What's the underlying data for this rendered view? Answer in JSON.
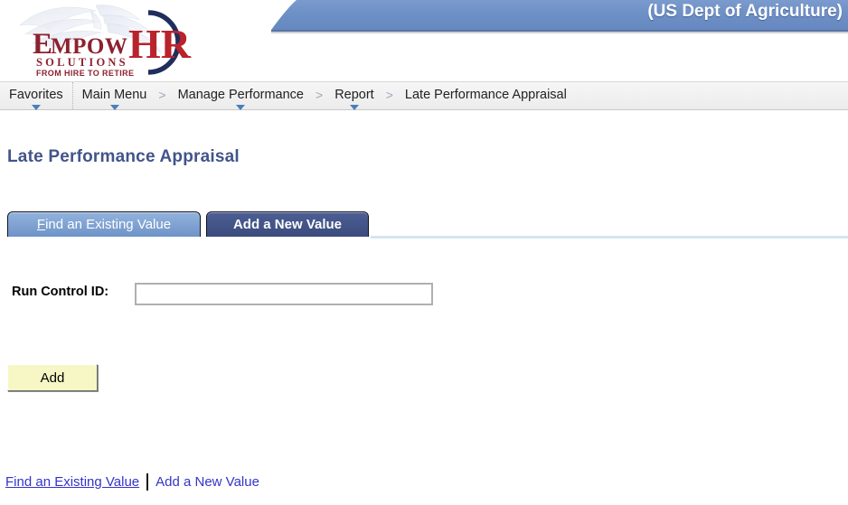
{
  "header": {
    "banner_title": "(US Dept of Agriculture)",
    "banner_color": "#6d90c6",
    "banner_border_color": "#3d5a93",
    "logo": {
      "word_1": "E",
      "word_1_rest": "MPOW",
      "word_2": "HR",
      "tagline_1": "S O L U T I O N S",
      "tagline_2": "FROM HIRE TO RETIRE",
      "color_empow": "#8c2230",
      "color_hr": "#b8232c",
      "color_arc": "#1f2e5c",
      "color_tagline": "#8c2230"
    }
  },
  "nav": {
    "items": [
      {
        "label": "Favorites",
        "caret": true,
        "separator_before": false
      },
      {
        "label": "Main Menu",
        "caret": true,
        "separator_before": true
      },
      {
        "label": "Manage Performance",
        "caret": true,
        "separator_before": false
      },
      {
        "label": "Report",
        "caret": true,
        "separator_before": false
      },
      {
        "label": "Late Performance Appraisal",
        "caret": false,
        "separator_before": false
      }
    ],
    "separator_glyph": ">"
  },
  "page": {
    "title": "Late Performance Appraisal",
    "title_color": "#42548a"
  },
  "tabs": {
    "find_existing": {
      "accesskey": "F",
      "label_rest": "ind an Existing Value",
      "active": false
    },
    "add_new": {
      "label": "Add a New Value",
      "active": true
    },
    "active_color": "#44558c",
    "inactive_color": "#7fa0cf",
    "underline_color": "#d4e6ef"
  },
  "form": {
    "run_control_label": "Run Control ID:",
    "run_control_value": "",
    "run_control_placeholder": ""
  },
  "actions": {
    "add_label": "Add",
    "add_bg": "#f7f7c6"
  },
  "footer": {
    "link_find": "Find an Existing Value",
    "link_add": "Add a New Value",
    "link_color": "#3333cc",
    "divider": "|"
  }
}
